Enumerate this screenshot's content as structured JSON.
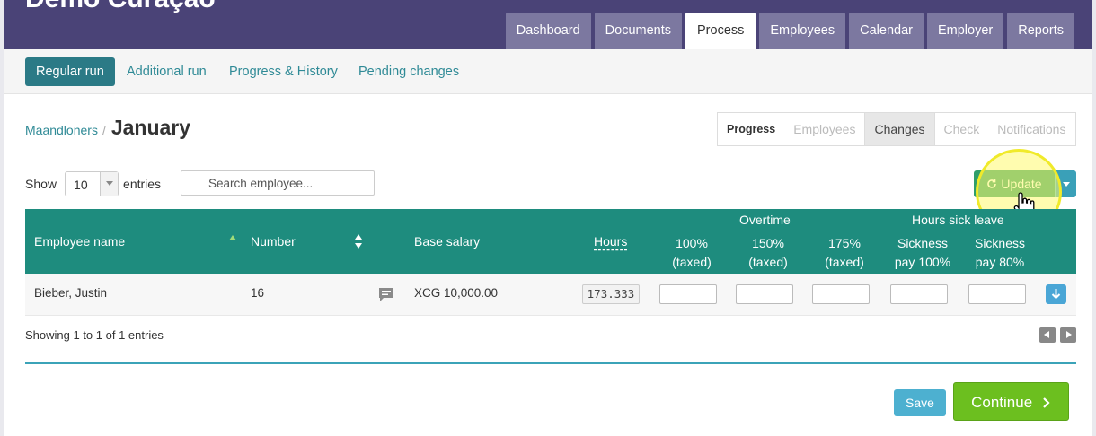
{
  "app": {
    "title": "Demo Curaçao"
  },
  "main_tabs": [
    "Dashboard",
    "Documents",
    "Process",
    "Employees",
    "Calendar",
    "Employer",
    "Reports"
  ],
  "main_tab_active": "Process",
  "subnav": [
    "Regular run",
    "Additional run",
    "Progress & History",
    "Pending changes"
  ],
  "breadcrumb": {
    "parent": "Maandloners",
    "separator": "/",
    "current": "January"
  },
  "steps": [
    "Progress",
    "Employees",
    "Changes",
    "Check",
    "Notifications"
  ],
  "show": {
    "label": "Show",
    "value": "10",
    "suffix": "entries"
  },
  "search": {
    "placeholder": "Search employee..."
  },
  "update": {
    "label": "Update"
  },
  "table": {
    "groups": {
      "overtime": "Overtime",
      "sick": "Hours sick leave"
    },
    "headers": {
      "name": "Employee name",
      "number": "Number",
      "base_salary": "Base salary",
      "hours": "Hours",
      "ot100_1": "100%",
      "ot100_2": "(taxed)",
      "ot150_1": "150%",
      "ot150_2": "(taxed)",
      "ot175_1": "175%",
      "ot175_2": "(taxed)",
      "sick100_1": "Sickness",
      "sick100_2": "pay 100%",
      "sick80_1": "Sickness",
      "sick80_2": "pay 80%"
    },
    "rows": [
      {
        "name": "Bieber, Justin",
        "number": "16",
        "base_salary": "XCG 10,000.00",
        "hours": "173.333"
      }
    ]
  },
  "info": {
    "text": "Showing 1 to 1 of 1 entries"
  },
  "footer": {
    "save": "Save",
    "continue": "Continue"
  },
  "colors": {
    "header": "#4a4377",
    "table_head": "#1e8c7e",
    "update": "#2f9e6a",
    "continue": "#6cbf1f",
    "save": "#4db0d0"
  }
}
